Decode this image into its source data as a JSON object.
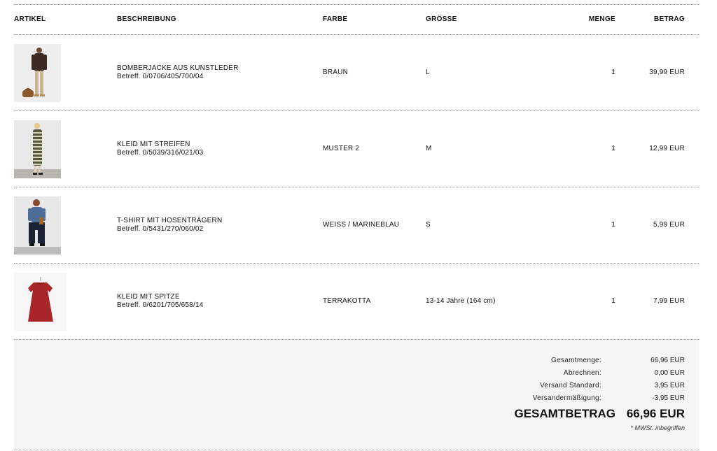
{
  "headers": {
    "artikel": "ARTIKEL",
    "beschreibung": "BESCHREIBUNG",
    "farbe": "FARBE",
    "groesse": "GRÖSSE",
    "menge": "MENGE",
    "betrag": "BETRAG"
  },
  "items": [
    {
      "name": "BOMBERJACKE AUS KUNSTLEDER",
      "ref": "Betreff. 0/0706/405/700/04",
      "color": "BRAUN",
      "size": "L",
      "qty": "1",
      "amount": "39,99 EUR",
      "image": "model-brown-leather-jacket"
    },
    {
      "name": "KLEID MIT STREIFEN",
      "ref": "Betreff. 0/5039/316/021/03",
      "color": "MUSTER 2",
      "size": "M",
      "qty": "1",
      "amount": "12,99 EUR",
      "image": "model-striped-dress"
    },
    {
      "name": "T-SHIRT MIT HOSENTRÄGERN",
      "ref": "Betreff. 0/5431/270/060/02",
      "color": "WEISS / MARINEBLAU",
      "size": "S",
      "qty": "1",
      "amount": "5,99 EUR",
      "image": "model-denim-suspenders"
    },
    {
      "name": "KLEID MIT SPITZE",
      "ref": "Betreff. 0/6201/705/658/14",
      "color": "TERRAKOTTA",
      "size": "13-14 Jahre (164 cm)",
      "qty": "1",
      "amount": "7,99 EUR",
      "image": "terracotta-lace-dress"
    }
  ],
  "summary": {
    "gesamtmenge_label": "Gesamtmenge:",
    "gesamtmenge_value": "66,96 EUR",
    "abrechnen_label": "Abrechnen:",
    "abrechnen_value": "0,00 EUR",
    "versand_label": "Versand Standard:",
    "versand_value": "3,95 EUR",
    "ermaessigung_label": "Versandermäßigung:",
    "ermaessigung_value": "-3,95 EUR",
    "total_label": "GESAMTBETRAG",
    "total_value": "66,96 EUR",
    "tax_note": "* MWSt. inbegriffen"
  }
}
